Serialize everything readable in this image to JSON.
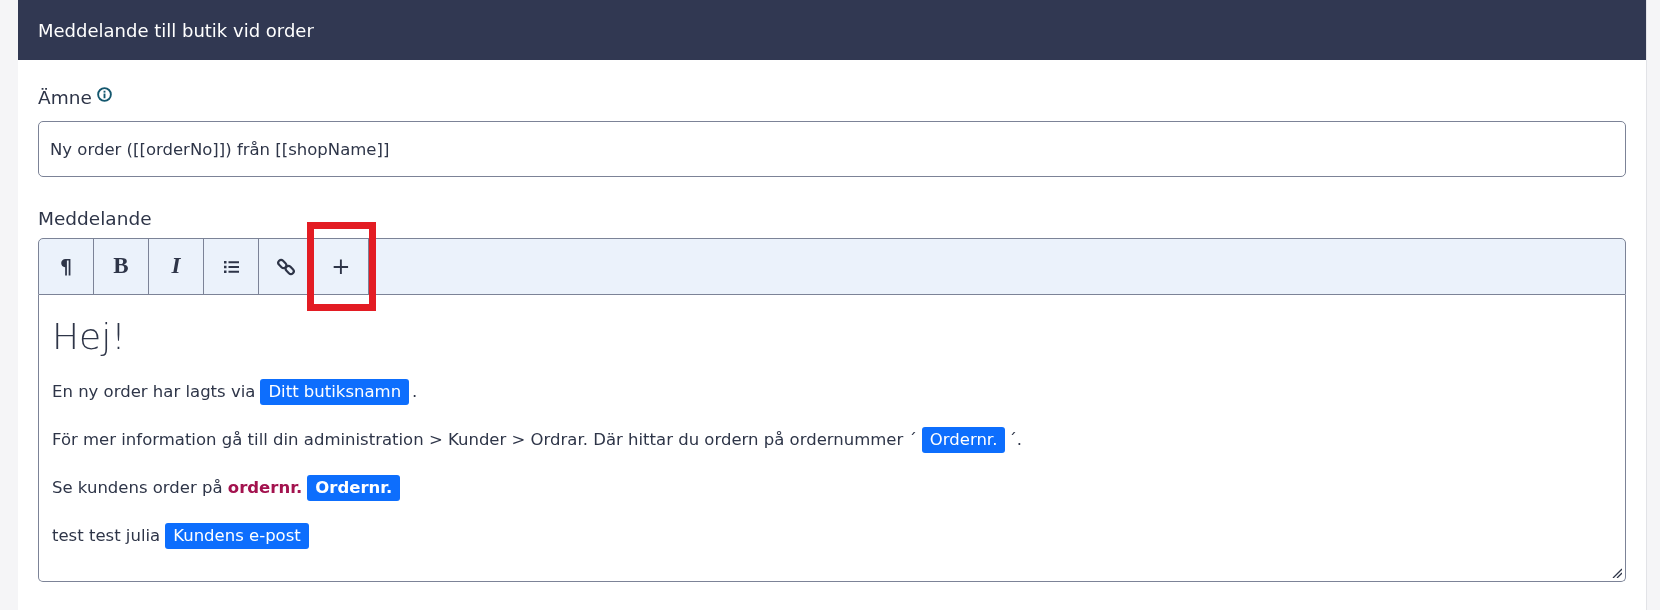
{
  "panel": {
    "title": "Meddelande till butik vid order"
  },
  "subject": {
    "label": "Ämne",
    "value": "Ny order ([[orderNo]]) från [[shopName]]"
  },
  "message": {
    "label": "Meddelande",
    "toolbar": [
      {
        "kind": "paragraph",
        "label": "¶",
        "highlighted": false
      },
      {
        "kind": "bold",
        "label": "B",
        "highlighted": false
      },
      {
        "kind": "italic",
        "label": "I",
        "highlighted": false
      },
      {
        "kind": "list",
        "highlighted": false
      },
      {
        "kind": "link",
        "highlighted": false
      },
      {
        "kind": "add",
        "label": "+",
        "highlighted": true
      }
    ],
    "heading": "Hej!",
    "paragraphs": [
      {
        "segments": [
          {
            "kind": "text",
            "text": "En ny order har lagts via"
          },
          {
            "kind": "tag",
            "text": "Ditt butiksnamn",
            "bold": false
          },
          {
            "kind": "text",
            "text": "."
          }
        ]
      },
      {
        "segments": [
          {
            "kind": "text",
            "text": "För mer information gå till din administration > Kunder > Ordrar. Där hittar du ordern på ordernummer ´"
          },
          {
            "kind": "tag",
            "text": "Ordernr.",
            "bold": false
          },
          {
            "kind": "text",
            "text": "´."
          }
        ]
      },
      {
        "segments": [
          {
            "kind": "text",
            "text": "Se kundens order på **ordernr.**"
          },
          {
            "kind": "tag",
            "text": "Ordernr.",
            "bold": true
          }
        ]
      },
      {
        "segments": [
          {
            "kind": "text",
            "text": "test test julia"
          },
          {
            "kind": "tag",
            "text": "Kundens e-post",
            "bold": false
          }
        ]
      }
    ]
  }
}
